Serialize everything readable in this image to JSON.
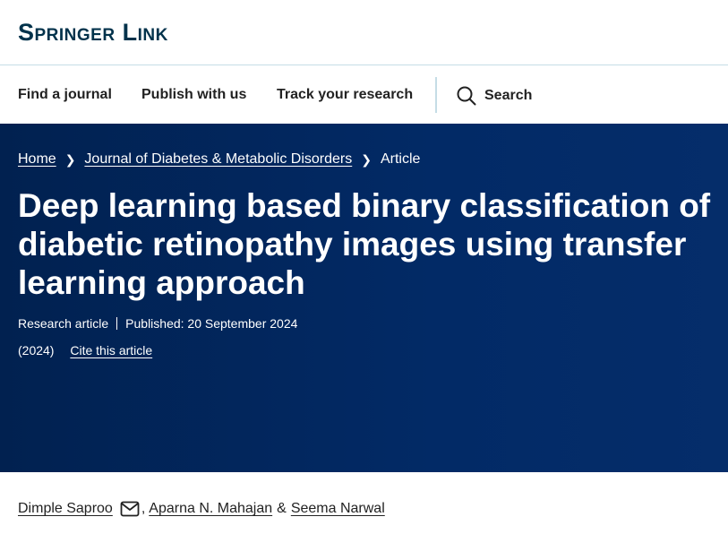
{
  "brand": {
    "logo_text": "Springer Link"
  },
  "nav": {
    "items": [
      {
        "label": "Find a journal"
      },
      {
        "label": "Publish with us"
      },
      {
        "label": "Track your research"
      }
    ],
    "search_label": "Search"
  },
  "breadcrumb": {
    "home": "Home",
    "journal": "Journal of Diabetes & Metabolic Disorders",
    "current": "Article"
  },
  "article": {
    "title": "Deep learning based binary classification of diabetic retinopathy images using transfer learning approach",
    "type": "Research article",
    "published": "Published: 20 September 2024",
    "year": "(2024)",
    "cite_label": "Cite this article"
  },
  "authors": {
    "list": [
      "Dimple Saproo",
      "Aparna N. Mahajan",
      "Seema Narwal"
    ],
    "sep_comma": ",",
    "sep_amp": "&"
  },
  "colors": {
    "brand_navy": "#01324b",
    "hero_bg": "#022a66",
    "divider": "#c5dde6"
  },
  "icons": {
    "search": "search-icon",
    "email": "envelope-icon",
    "chevron": "chevron-right-icon"
  }
}
